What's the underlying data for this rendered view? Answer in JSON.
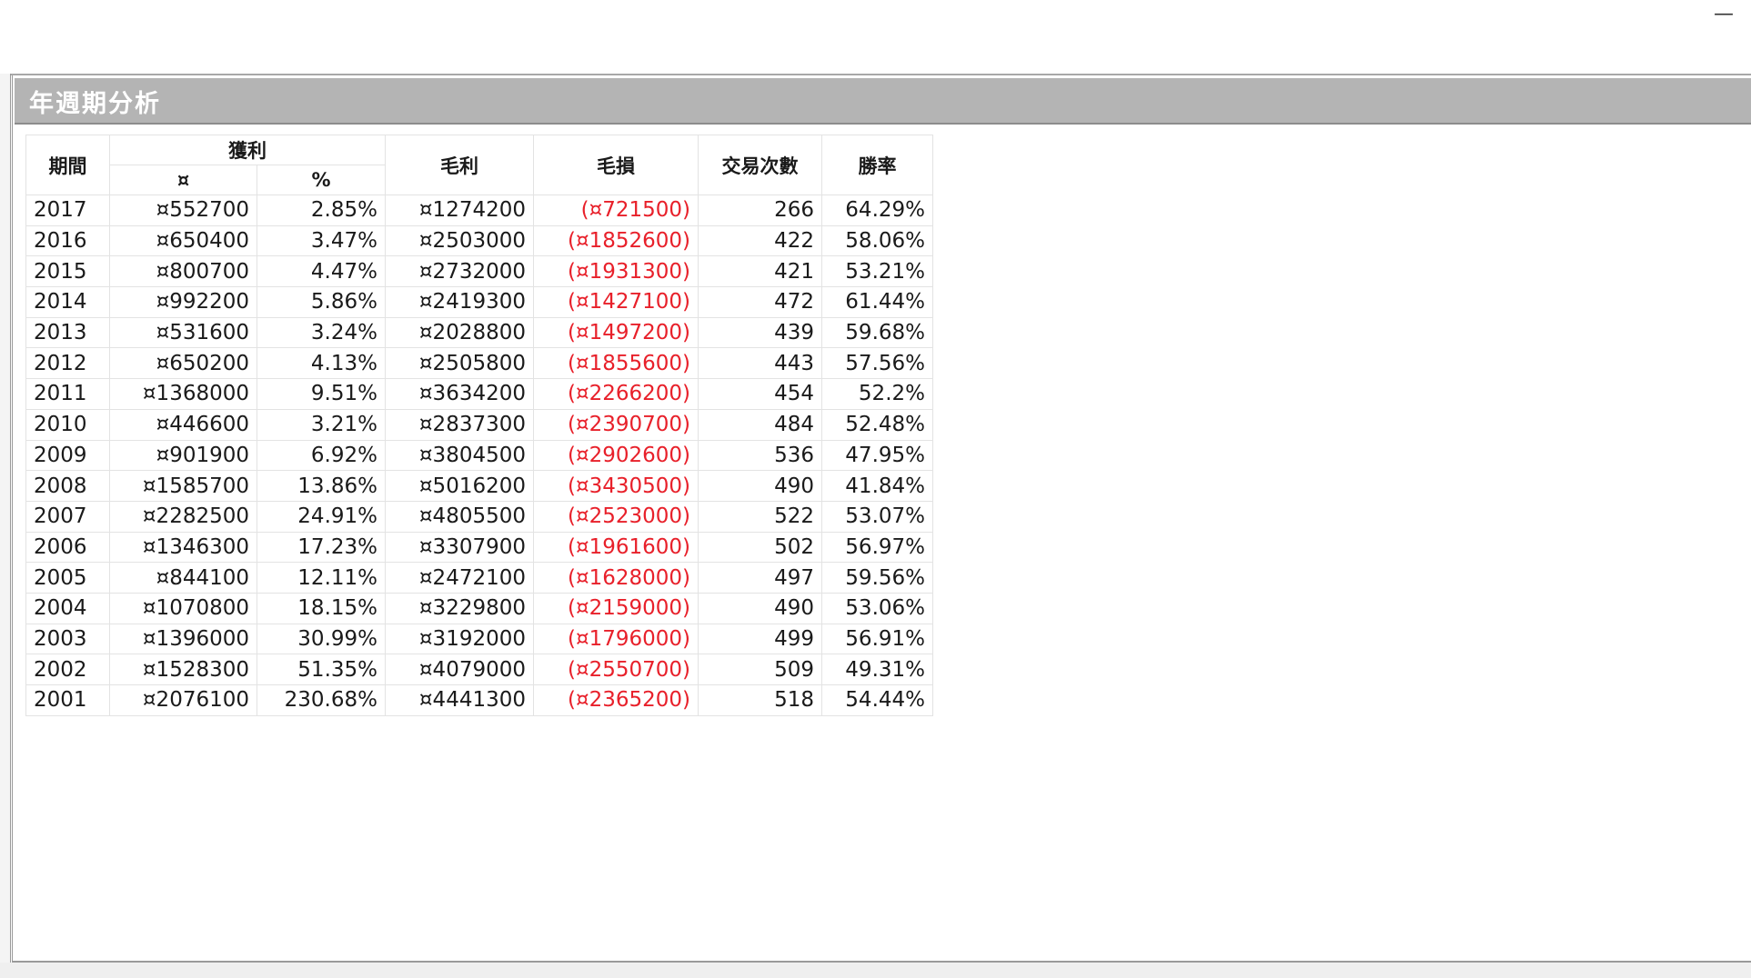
{
  "window": {
    "minimize_glyph": "—"
  },
  "panel": {
    "title": "年週期分析"
  },
  "table": {
    "headers": {
      "period": "期間",
      "profit": "獲利",
      "profit_currency": "¤",
      "profit_percent": "%",
      "gross_profit": "毛利",
      "gross_loss": "毛損",
      "trades": "交易次數",
      "win_rate": "勝率"
    },
    "rows": [
      {
        "year": "2017",
        "profit": "¤552700",
        "pct": "2.85%",
        "gross_profit": "¤1274200",
        "gross_loss": "(¤721500)",
        "trades": "266",
        "win_rate": "64.29%"
      },
      {
        "year": "2016",
        "profit": "¤650400",
        "pct": "3.47%",
        "gross_profit": "¤2503000",
        "gross_loss": "(¤1852600)",
        "trades": "422",
        "win_rate": "58.06%"
      },
      {
        "year": "2015",
        "profit": "¤800700",
        "pct": "4.47%",
        "gross_profit": "¤2732000",
        "gross_loss": "(¤1931300)",
        "trades": "421",
        "win_rate": "53.21%"
      },
      {
        "year": "2014",
        "profit": "¤992200",
        "pct": "5.86%",
        "gross_profit": "¤2419300",
        "gross_loss": "(¤1427100)",
        "trades": "472",
        "win_rate": "61.44%"
      },
      {
        "year": "2013",
        "profit": "¤531600",
        "pct": "3.24%",
        "gross_profit": "¤2028800",
        "gross_loss": "(¤1497200)",
        "trades": "439",
        "win_rate": "59.68%"
      },
      {
        "year": "2012",
        "profit": "¤650200",
        "pct": "4.13%",
        "gross_profit": "¤2505800",
        "gross_loss": "(¤1855600)",
        "trades": "443",
        "win_rate": "57.56%"
      },
      {
        "year": "2011",
        "profit": "¤1368000",
        "pct": "9.51%",
        "gross_profit": "¤3634200",
        "gross_loss": "(¤2266200)",
        "trades": "454",
        "win_rate": "52.2%"
      },
      {
        "year": "2010",
        "profit": "¤446600",
        "pct": "3.21%",
        "gross_profit": "¤2837300",
        "gross_loss": "(¤2390700)",
        "trades": "484",
        "win_rate": "52.48%"
      },
      {
        "year": "2009",
        "profit": "¤901900",
        "pct": "6.92%",
        "gross_profit": "¤3804500",
        "gross_loss": "(¤2902600)",
        "trades": "536",
        "win_rate": "47.95%"
      },
      {
        "year": "2008",
        "profit": "¤1585700",
        "pct": "13.86%",
        "gross_profit": "¤5016200",
        "gross_loss": "(¤3430500)",
        "trades": "490",
        "win_rate": "41.84%"
      },
      {
        "year": "2007",
        "profit": "¤2282500",
        "pct": "24.91%",
        "gross_profit": "¤4805500",
        "gross_loss": "(¤2523000)",
        "trades": "522",
        "win_rate": "53.07%"
      },
      {
        "year": "2006",
        "profit": "¤1346300",
        "pct": "17.23%",
        "gross_profit": "¤3307900",
        "gross_loss": "(¤1961600)",
        "trades": "502",
        "win_rate": "56.97%"
      },
      {
        "year": "2005",
        "profit": "¤844100",
        "pct": "12.11%",
        "gross_profit": "¤2472100",
        "gross_loss": "(¤1628000)",
        "trades": "497",
        "win_rate": "59.56%"
      },
      {
        "year": "2004",
        "profit": "¤1070800",
        "pct": "18.15%",
        "gross_profit": "¤3229800",
        "gross_loss": "(¤2159000)",
        "trades": "490",
        "win_rate": "53.06%"
      },
      {
        "year": "2003",
        "profit": "¤1396000",
        "pct": "30.99%",
        "gross_profit": "¤3192000",
        "gross_loss": "(¤1796000)",
        "trades": "499",
        "win_rate": "56.91%"
      },
      {
        "year": "2002",
        "profit": "¤1528300",
        "pct": "51.35%",
        "gross_profit": "¤4079000",
        "gross_loss": "(¤2550700)",
        "trades": "509",
        "win_rate": "49.31%"
      },
      {
        "year": "2001",
        "profit": "¤2076100",
        "pct": "230.68%",
        "gross_profit": "¤4441300",
        "gross_loss": "(¤2365200)",
        "trades": "518",
        "win_rate": "54.44%"
      }
    ]
  },
  "colors": {
    "title_bar": "#b4b4b4",
    "negative": "#e8202a",
    "grid": "#e3e3e3"
  }
}
